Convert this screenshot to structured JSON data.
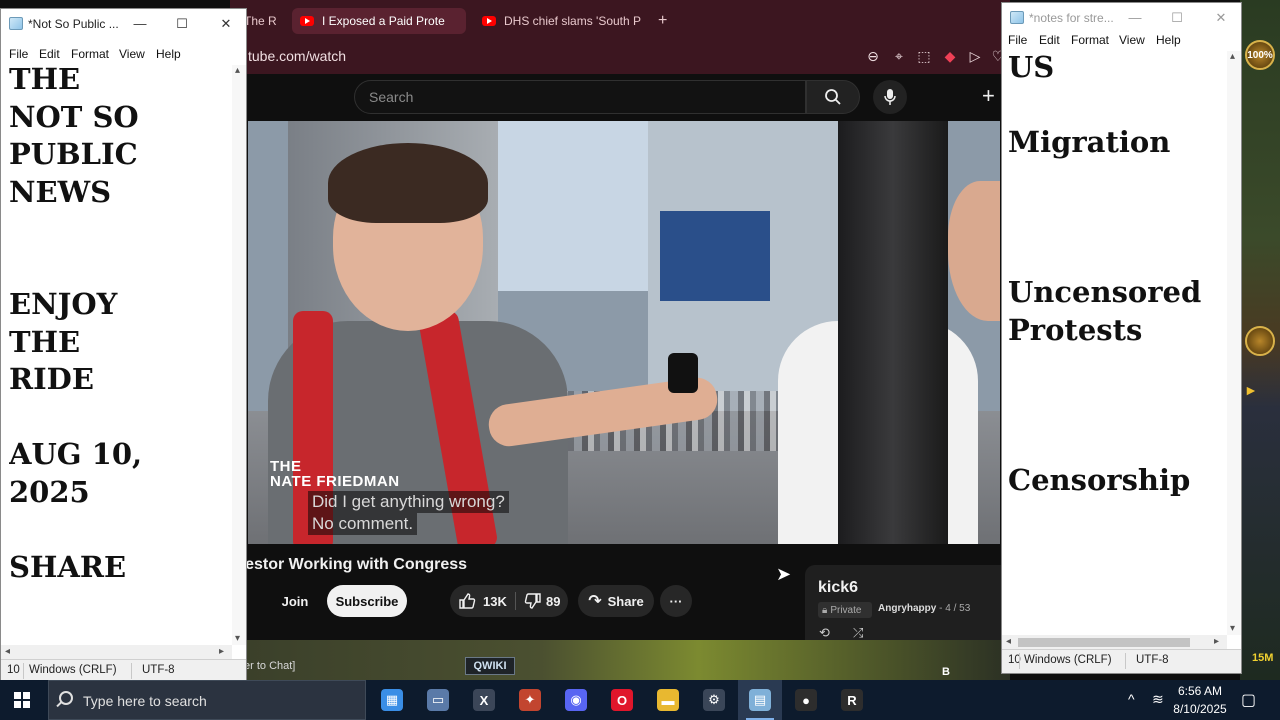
{
  "browser": {
    "tabs": [
      {
        "label": "The R",
        "active": false
      },
      {
        "label": "I Exposed a Paid Prote",
        "active": true
      },
      {
        "label": "DHS chief slams 'South P",
        "active": false
      }
    ],
    "new_tab_symbol": "+",
    "url": "tube.com/watch",
    "toolbar_icons": [
      "zoom-out-icon",
      "pin-icon",
      "screenshot-icon",
      "pocket-icon",
      "send-icon",
      "heart-icon"
    ]
  },
  "youtube": {
    "search_placeholder": "Search",
    "create_symbol": "+",
    "video": {
      "watermark_line1": "THE",
      "watermark_line2": "NATE FRIEDMAN",
      "caption_line1": "Did I get anything wrong?",
      "caption_line2": "No comment.",
      "title": "otestor Working with Congress"
    },
    "actions": {
      "join": "Join",
      "subscribe": "Subscribe",
      "likes": "13K",
      "dislikes": "89",
      "share": "Share",
      "more": "···"
    },
    "playlist": {
      "title": "kick6",
      "privacy": "Private",
      "owner": "Angryhappy",
      "position": "- 4 / 53",
      "loop_symbol": "⟲",
      "shuffle_symbol": "⤮"
    },
    "colors": {
      "accent": "#ff0000",
      "tab_bg": "#3c1620"
    }
  },
  "game_overlay": {
    "chat_hint": "er to Chat]",
    "qwiki_label": "QWIKI",
    "chip_label": "100%",
    "bottom_value": "15M",
    "b_label": "B"
  },
  "notepad_left": {
    "title": "*Not So Public ...",
    "menu": [
      "File",
      "Edit",
      "Format",
      "View",
      "Help"
    ],
    "content": "THE\nNOT SO\nPUBLIC\nNEWS\n\n\nENJOY\nTHE\nRIDE\n\nAUG 10,\n2025\n\nSHARE",
    "status": {
      "position": "10",
      "line_ending": "Windows (CRLF)",
      "encoding": "UTF-8"
    }
  },
  "notepad_right": {
    "title": "*notes for stre...",
    "menu": [
      "File",
      "Edit",
      "Format",
      "View",
      "Help"
    ],
    "content": "US\n\nMigration\n\n\n\nUncensored\nProtests\n\n\n\nCensorship",
    "status": {
      "position": "10",
      "line_ending": "Windows (CRLF)",
      "encoding": "UTF-8"
    }
  },
  "taskbar": {
    "search_placeholder": "Type here to search",
    "apps": [
      {
        "name": "calculator",
        "label": "▦",
        "color": "#3a8ee6"
      },
      {
        "name": "photos",
        "label": "▭",
        "color": "#5a7aa8"
      },
      {
        "name": "xcode-like",
        "label": "X",
        "color": "#3b4658"
      },
      {
        "name": "game-launcher",
        "label": "✦",
        "color": "#c2452f"
      },
      {
        "name": "discord",
        "label": "◉",
        "color": "#5865f2"
      },
      {
        "name": "opera",
        "label": "O",
        "color": "#e0162b"
      },
      {
        "name": "file-explorer",
        "label": "▬",
        "color": "#e8b830"
      },
      {
        "name": "settings",
        "label": "⚙",
        "color": "#3a4658"
      },
      {
        "name": "notepad",
        "label": "▤",
        "color": "#7fb0d8"
      },
      {
        "name": "obs-studio",
        "label": "●",
        "color": "#2d2d2d"
      },
      {
        "name": "mixer",
        "label": "R",
        "color": "#2d2d2d"
      }
    ],
    "time": "6:56 AM",
    "date": "8/10/2025",
    "tray_symbols": {
      "chevron": "^",
      "network": "≋",
      "notifications": "▢"
    }
  }
}
